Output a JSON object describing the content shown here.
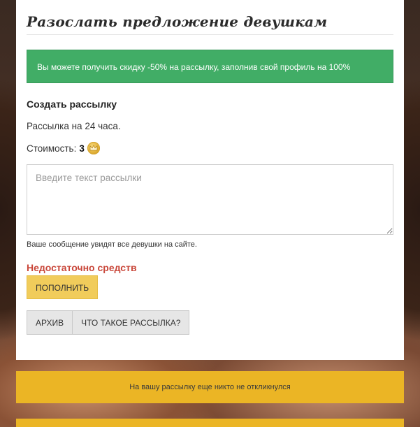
{
  "page": {
    "title": "Разослать предложение девушкам"
  },
  "promo": {
    "text": "Вы можете получить скидку -50% на рассылку, заполнив свой профиль на 100%",
    "color": "#41ad66"
  },
  "mailing": {
    "section_title": "Создать рассылку",
    "duration_text": "Рассылка на 24 часа.",
    "cost_label": "Стоимость:",
    "cost_value": "3",
    "cost_icon": "coin-icon",
    "message_placeholder": "Введите текст рассылки",
    "message_value": "",
    "hint": "Ваше сообщение увидят все девушки на сайте."
  },
  "balance": {
    "warning": "Недостаточно средств",
    "warning_color": "#c9473a",
    "topup_label": "ПОПОЛНИТЬ",
    "topup_color": "#f1cc5b"
  },
  "actions": {
    "archive_label": "АРХИВ",
    "about_label": "ЧТО ТАКОЕ РАССЫЛКА?"
  },
  "notice": {
    "text": "На вашу рассылку еще никто не откликнулся",
    "color": "#ebb525"
  }
}
